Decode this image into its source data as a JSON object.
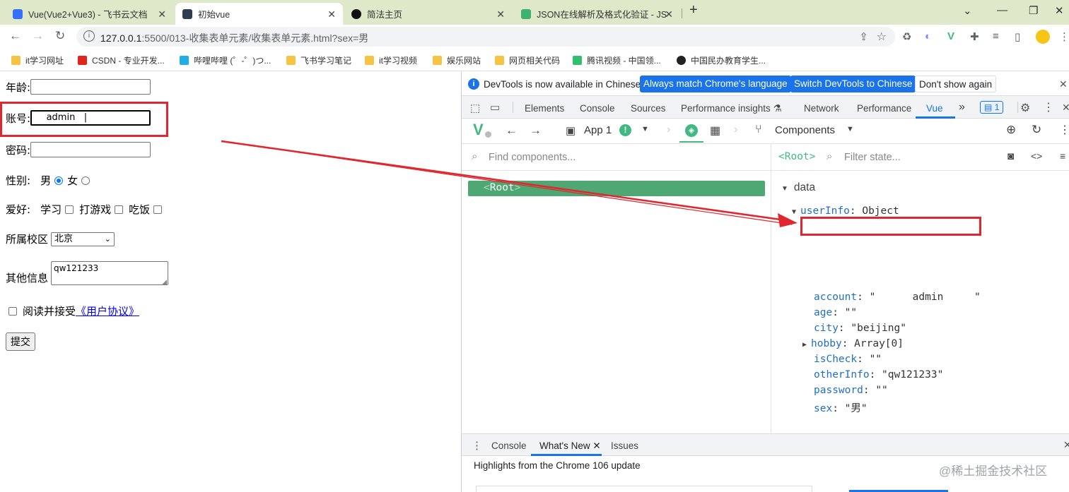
{
  "tabs": [
    {
      "title": "Vue(Vue2+Vue3) - 飞书云文档",
      "favicon_color": "#3370ff"
    },
    {
      "title": "初始vue",
      "favicon_color": "#2c3e50",
      "active": true
    },
    {
      "title": "简法主页",
      "favicon_color": "#111111"
    },
    {
      "title": "JSON在线解析及格式化验证 - JS",
      "favicon_color": "#3cb371"
    }
  ],
  "new_tab": "+",
  "url": {
    "host": "127.0.0.1",
    "path": ":5500/013-收集表单元素/收集表单元素.html?sex=男"
  },
  "bookmarks": [
    "it学习网址",
    "CSDN - 专业开发...",
    "哔哩哔哩 (゜-゜)つ...",
    "飞书学习笔记",
    "it学习视频",
    "娱乐网站",
    "网页相关代码",
    "腾讯视频 - 中国领...",
    "中国民办教育学生..."
  ],
  "form": {
    "age_label": "年龄:",
    "account_label": "账号:",
    "account_value": "    admin   |",
    "password_label": "密码:",
    "sex_label": "性别:",
    "sex_male": "男",
    "sex_female": "女",
    "hobby_label": "爱好:",
    "hobby_study": "学习",
    "hobby_game": "打游戏",
    "hobby_eat": "吃饭",
    "campus_label": "所属校区",
    "campus_value": "北京",
    "other_label": "其他信息",
    "other_value": "qw121233",
    "agree_prefix": "阅读并接受",
    "agree_link": "《用户协议》",
    "submit": "提交"
  },
  "devtools": {
    "banner_text": "DevTools is now available in Chinese!",
    "banner_btn1": "Always match Chrome's language",
    "banner_btn2": "Switch DevTools to Chinese",
    "banner_btn3": "Don't show again",
    "tabs": [
      "Elements",
      "Console",
      "Sources",
      "Performance insights",
      "Network",
      "Performance",
      "Vue"
    ],
    "more": "»",
    "issues_count": "1",
    "app_label": "App 1",
    "components_label": "Components",
    "find_placeholder": "Find components...",
    "root_label": "<Root>",
    "root_tag": "Root",
    "filter_placeholder": "Filter state...",
    "section_data": "data",
    "userinfo_key": "userInfo",
    "userinfo_type": "Object",
    "fields": [
      {
        "key": "account",
        "value": "\"      admin     \""
      },
      {
        "key": "age",
        "value": "\"\""
      },
      {
        "key": "city",
        "value": "\"beijing\""
      },
      {
        "key": "hobby",
        "value": "Array[0]",
        "expandable": true
      },
      {
        "key": "isCheck",
        "value": "\"\""
      },
      {
        "key": "otherInfo",
        "value": "\"qw121233\""
      },
      {
        "key": "password",
        "value": "\"\""
      },
      {
        "key": "sex",
        "value": "\"男\""
      }
    ],
    "drawer_tabs": [
      "Console",
      "What's New",
      "Issues"
    ],
    "drawer_text": "Highlights from the Chrome 106 update"
  },
  "watermark": "@稀土掘金技术社区",
  "colors": {
    "accent_blue": "#1a73e8",
    "vue_green": "#42b883",
    "annotation_red": "#e0262e",
    "tab_strip": "#dfe8c9"
  }
}
